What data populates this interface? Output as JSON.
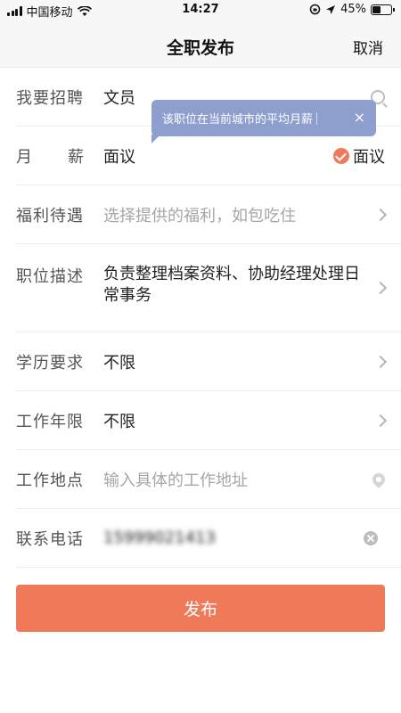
{
  "status_bar": {
    "carrier": "中国移动",
    "time": "14:27",
    "battery": "45%",
    "battery_level": 0.45
  },
  "nav": {
    "title": "全职发布",
    "cancel": "取消"
  },
  "form": {
    "job": {
      "label": "我要招聘",
      "value": "文员"
    },
    "salary": {
      "label_a": "月",
      "label_b": "薪",
      "value": "面议",
      "negotiable": "面议"
    },
    "benefits": {
      "label": "福利待遇",
      "placeholder": "选择提供的福利，如包吃住"
    },
    "description": {
      "label": "职位描述",
      "value": "负责整理档案资料、协助经理处理日常事务"
    },
    "education": {
      "label": "学历要求",
      "value": "不限"
    },
    "experience": {
      "label": "工作年限",
      "value": "不限"
    },
    "location": {
      "label": "工作地点",
      "placeholder": "输入具体的工作地址"
    },
    "phone": {
      "label": "联系电话",
      "value": "15999021413"
    }
  },
  "tooltip": {
    "text": "该职位在当前城市的平均月薪",
    "close": "×"
  },
  "publish_button": "发布",
  "colors": {
    "accent": "#ee7a5a",
    "tooltip": "#8e9fce"
  }
}
